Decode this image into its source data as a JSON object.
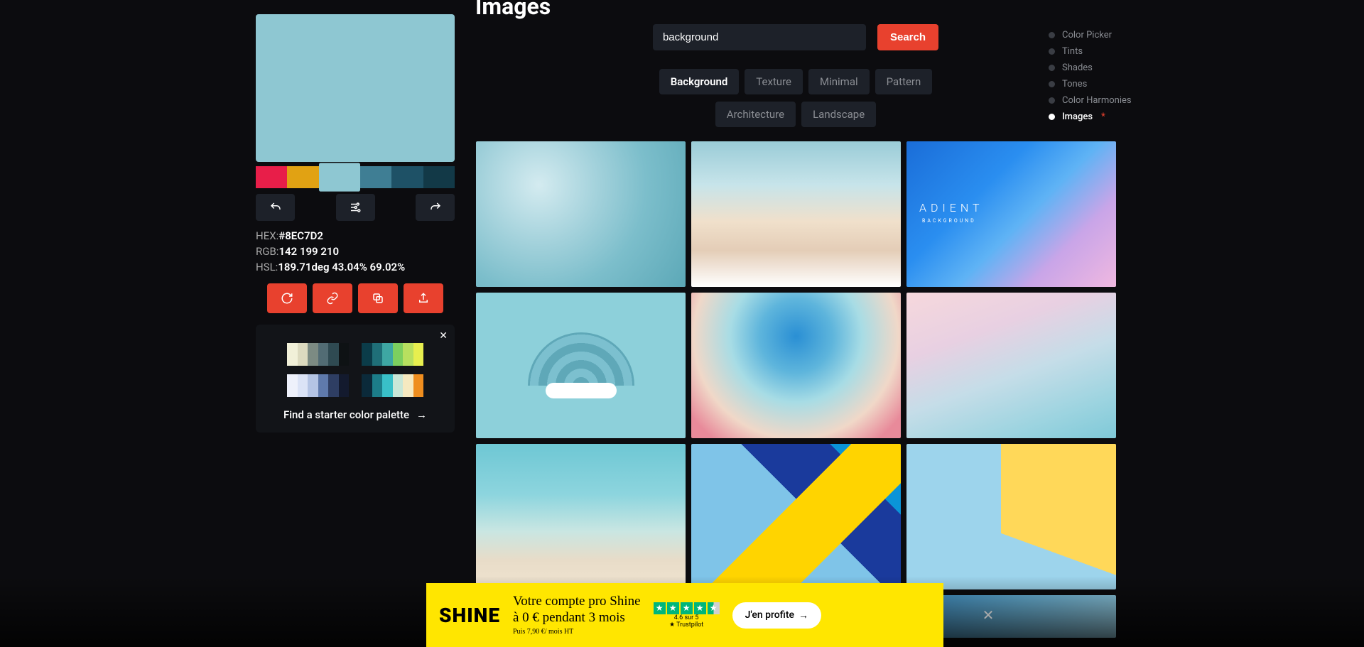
{
  "header": {
    "title": "Images"
  },
  "color": {
    "swatch": "#8EC7D2",
    "palette": [
      "#e81e49",
      "#e1a213",
      "#8EC7D2",
      "#3f7e94",
      "#1e5166",
      "#123947"
    ],
    "hex_label": "HEX:",
    "hex_value": "#8EC7D2",
    "rgb_label": "RGB:",
    "rgb_value": "142 199 210",
    "hsl_label": "HSL:",
    "hsl_value": "189.71deg 43.04% 69.02%"
  },
  "starter": {
    "text": "Find a starter color palette",
    "palettes": [
      [
        "#f1f0d8",
        "#dcdabf",
        "#7c8b83",
        "#526c74",
        "#2f4a52",
        "#0e1214"
      ],
      [
        "#0b3c49",
        "#1f6f78",
        "#3ea7a3",
        "#7ccf5f",
        "#b7e05f",
        "#e7ef4f"
      ],
      [
        "#eef1fb",
        "#dbe3f6",
        "#b4c4e4",
        "#5f7aac",
        "#2e3e63",
        "#131a2e"
      ],
      [
        "#0b2a3a",
        "#1c7d89",
        "#39c0c8",
        "#c9e7d7",
        "#f6e9c0",
        "#ef8e1f"
      ]
    ]
  },
  "search": {
    "value": "background",
    "button": "Search"
  },
  "tags": {
    "row1": [
      {
        "label": "Background",
        "active": true
      },
      {
        "label": "Texture",
        "active": false
      },
      {
        "label": "Minimal",
        "active": false
      },
      {
        "label": "Pattern",
        "active": false
      }
    ],
    "row2": [
      {
        "label": "Architecture",
        "active": false
      },
      {
        "label": "Landscape",
        "active": false
      }
    ]
  },
  "nav": [
    {
      "label": "Color Picker",
      "active": false,
      "star": false
    },
    {
      "label": "Tints",
      "active": false,
      "star": false
    },
    {
      "label": "Shades",
      "active": false,
      "star": false
    },
    {
      "label": "Tones",
      "active": false,
      "star": false
    },
    {
      "label": "Color Harmonies",
      "active": false,
      "star": false
    },
    {
      "label": "Images",
      "active": true,
      "star": true
    }
  ],
  "thumbs": {
    "gradient_label": "ADIENT",
    "gradient_sub": "BACKGROUND"
  },
  "ad": {
    "logo": "SHINE",
    "line1a": "Votre compte pro Shine",
    "line1b": "à 0 € pendant 3 mois",
    "line2": "Puis 7,90 €/ mois HT",
    "rating": "4.6 sur 5",
    "trust": "Trustpilot",
    "cta": "J'en profite"
  }
}
